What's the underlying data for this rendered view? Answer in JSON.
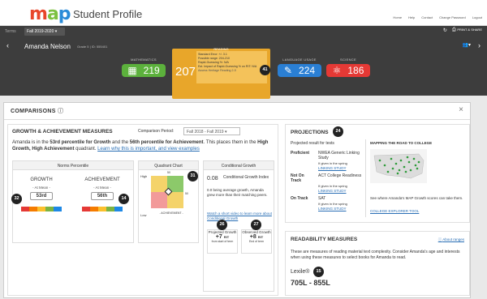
{
  "app": {
    "logo": "map",
    "title": "Student Profile"
  },
  "top_links": [
    "Home",
    "Help",
    "Contact",
    "Change Password",
    "Logout"
  ],
  "term": {
    "label": "Terms",
    "value": "Fall 2019-2020",
    "print": "PRINT & SHARE"
  },
  "student": {
    "name": "Amanda Nelson",
    "grade": "Grade 5",
    "id": "ID: 555401"
  },
  "scores": [
    {
      "label": "MATHEMATICS",
      "value": "219",
      "color": "#5cb13c"
    },
    {
      "label": "LANGUAGE USAGE",
      "value": "224",
      "color": "#2a7fd4"
    },
    {
      "label": "SCIENCE",
      "value": "186",
      "color": "#e53935"
    }
  ],
  "reading": {
    "label": "READING",
    "value": "207",
    "tip": [
      "Standard Error: +/- 3.1",
      "Possible range: 204-210",
      "Rapid-Guessing %: N/A",
      "Est. Impact of Rapid-Guessing % on RIT: N/A"
    ],
    "note": "Assess Heritage  Reading 2-5"
  },
  "comparisons": {
    "title": "COMPARISONS",
    "close": "×"
  },
  "growth": {
    "title": "GROWTH & ACHIEVEMENT MEASURES",
    "period_label": "Comparison Period:",
    "period_value": "Fall 2018 - Fall 2019",
    "desc_pre": "Amanda is in the ",
    "desc_b1": "53rd percentile for Growth",
    "desc_mid": " and the ",
    "desc_b2": "56th percentile for Achievement",
    "desc_post": ". This places them in the ",
    "desc_b3": "High Growth, High Achievement",
    "desc_end": " quadrant. ",
    "desc_link": "Learn why this is important, and view examples",
    "norms_title": "Norms Percentile",
    "growth_label": "GROWTH",
    "ach_label": "ACHIEVEMENT",
    "atmean": "- At Mean -",
    "growth_pct": "53rd",
    "ach_pct": "56th",
    "quad_title": "Quadrant Chart",
    "quad_high": "High",
    "quad_low": "Low",
    "quad_x": "- ACHIEVEMENT -",
    "quad_tick": "50",
    "cg_title": "Conditional Growth",
    "cg_value": "0.08",
    "cg_label": "Conditional Growth Index",
    "cg_desc": "0.0 being average growth, Amanda grew more than their matching peers.",
    "cg_link": "Watch a short video to learn more about Conditional Growth",
    "proj_label": "Projected Growth",
    "proj_value": "+7",
    "proj_unit": "RIT",
    "proj_sub": "from start of term",
    "obs_label": "Observed Growth",
    "obs_value": "+8",
    "obs_unit": "RIT",
    "obs_sub": "End of term"
  },
  "badges": [
    "31",
    "32",
    "14",
    "26",
    "27",
    "24",
    "41",
    "15"
  ],
  "projections": {
    "title": "PROJECTIONS",
    "sub": "Projected result for tests",
    "rows": [
      {
        "status": "Proficient",
        "test": "NWEA Generic Linking Study",
        "note": "If given in the spring",
        "link": "LINKING STUDY"
      },
      {
        "status": "Not On Track",
        "test": "ACT College Readiness",
        "note": "If given in the spring",
        "link": "LINKING STUDY"
      },
      {
        "status": "On Track",
        "test": "SAT",
        "note": "If given in the spring",
        "link": "LINKING STUDY"
      }
    ],
    "map_title": "MAPPING THE ROAD TO COLLEGE",
    "map_desc": "See where Amanda's MAP Growth scores can take them.",
    "map_link": "COLLEGE EXPLORER TOOL"
  },
  "readability": {
    "title": "READABILITY MEASURES",
    "about": "About ranges",
    "desc": "These are measures of reading material text complexity. Consider Amanda's age and interests when using these measures to select books for Amanda to read.",
    "lexile_label": "Lexile®",
    "lexile_value": "705L - 855L"
  }
}
